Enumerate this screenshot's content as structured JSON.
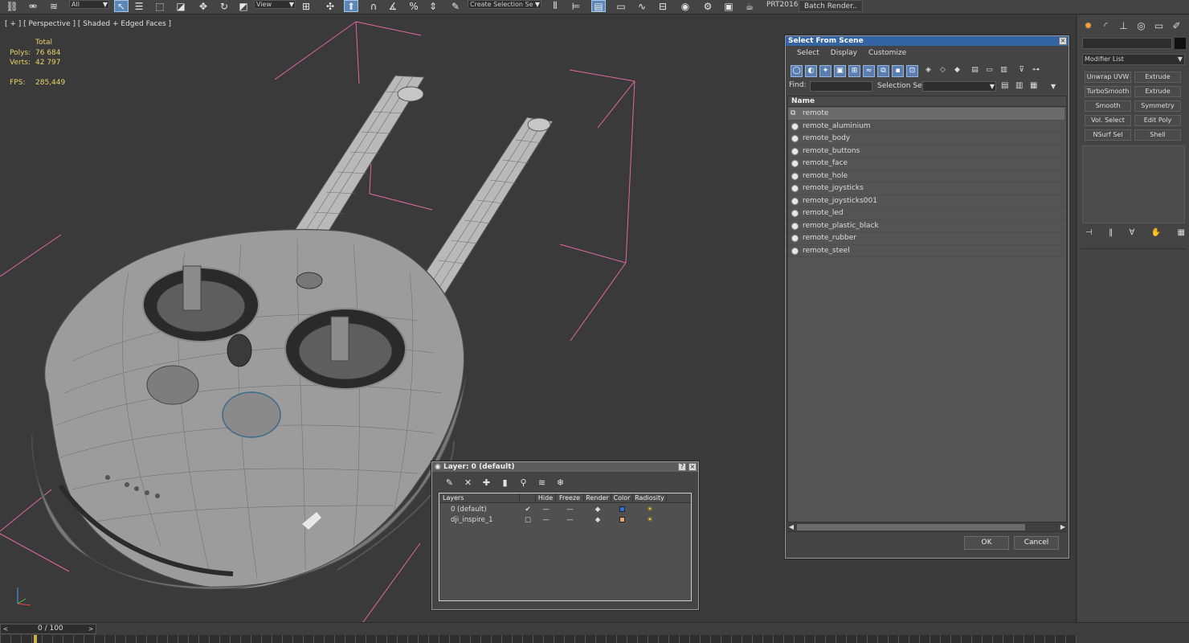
{
  "toolbar": {
    "selection_filter": "All",
    "ref_coord": "View",
    "named_selection": "Create Selection Se",
    "prt_label": "PRT2016",
    "batch_render": "Batch Render..",
    "icons": [
      "link-icon",
      "unlink-icon",
      "bind-spacewarp-icon",
      "select-object-icon",
      "select-by-name-icon",
      "rect-selection-icon",
      "window-crossing-icon",
      "move-icon",
      "rotate-icon",
      "scale-icon",
      "pivot-icon",
      "manipulate-icon",
      "snap-toggle-icon",
      "angle-snap-icon",
      "percent-snap-icon",
      "spinner-snap-icon",
      "edit-named-sel-icon",
      "mirror-icon",
      "align-icon",
      "layer-manager-icon",
      "ribbon-icon",
      "curve-editor-icon",
      "schematic-icon",
      "material-editor-icon",
      "render-setup-icon",
      "render-frame-icon",
      "render-icon",
      "render-teapot-icon"
    ]
  },
  "viewport": {
    "label": "[ + ] [ Perspective ] [ Shaded + Edged Faces ]",
    "stats": {
      "total_label": "Total",
      "polys_label": "Polys:",
      "polys_value": "76 684",
      "verts_label": "Verts:",
      "verts_value": "42 797",
      "fps_label": "FPS:",
      "fps_value": "285,449"
    }
  },
  "select_from_scene": {
    "title": "Select From Scene",
    "menu": [
      "Select",
      "Display",
      "Customize"
    ],
    "find_label": "Find:",
    "selection_set_label": "Selection Set:",
    "column_name": "Name",
    "objects": [
      {
        "name": "remote",
        "type": "group",
        "selected": true
      },
      {
        "name": "remote_aluminium",
        "type": "object"
      },
      {
        "name": "remote_body",
        "type": "object"
      },
      {
        "name": "remote_buttons",
        "type": "object"
      },
      {
        "name": "remote_face",
        "type": "object"
      },
      {
        "name": "remote_hole",
        "type": "object"
      },
      {
        "name": "remote_joysticks",
        "type": "object"
      },
      {
        "name": "remote_joysticks001",
        "type": "object"
      },
      {
        "name": "remote_led",
        "type": "object"
      },
      {
        "name": "remote_plastic_black",
        "type": "object"
      },
      {
        "name": "remote_rubber",
        "type": "object"
      },
      {
        "name": "remote_steel",
        "type": "object"
      }
    ],
    "ok_label": "OK",
    "cancel_label": "Cancel"
  },
  "layer_dialog": {
    "title": "Layer: 0 (default)",
    "help_label": "?",
    "close_label": "×",
    "columns": [
      "Layers",
      "Hide",
      "Freeze",
      "Render",
      "Color",
      "Radiosity"
    ],
    "layers": [
      {
        "name": "0 (default)",
        "active": true,
        "color": "#2f6fd0"
      },
      {
        "name": "dji_inspire_1",
        "active": false,
        "color": "#e8a878"
      }
    ]
  },
  "command_panel": {
    "modifier_list": "Modifier List",
    "modifiers": [
      "Unwrap UVW",
      "Extrude",
      "TurboSmooth",
      "Extrude",
      "Smooth",
      "Symmetry",
      "Vol. Select",
      "Edit Poly",
      "NSurf Sel",
      "Shell"
    ]
  },
  "timeline": {
    "frame_label": "0 / 100",
    "prev_label": "<",
    "next_label": ">"
  }
}
